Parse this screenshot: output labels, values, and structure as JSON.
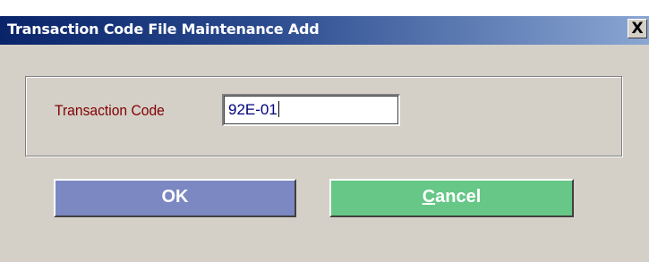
{
  "window": {
    "title": "Transaction Code File Maintenance Add",
    "close_label": "X"
  },
  "form": {
    "transaction_code_label": "Transaction Code",
    "transaction_code_value": "92E-01"
  },
  "buttons": {
    "ok_label": "OK",
    "cancel_mnemonic": "C",
    "cancel_rest": "ancel"
  },
  "colors": {
    "title_bar": "#0a246a",
    "ok_button": "#7b88c1",
    "cancel_button": "#66c787",
    "label_text": "#800000",
    "input_text": "#000080"
  }
}
